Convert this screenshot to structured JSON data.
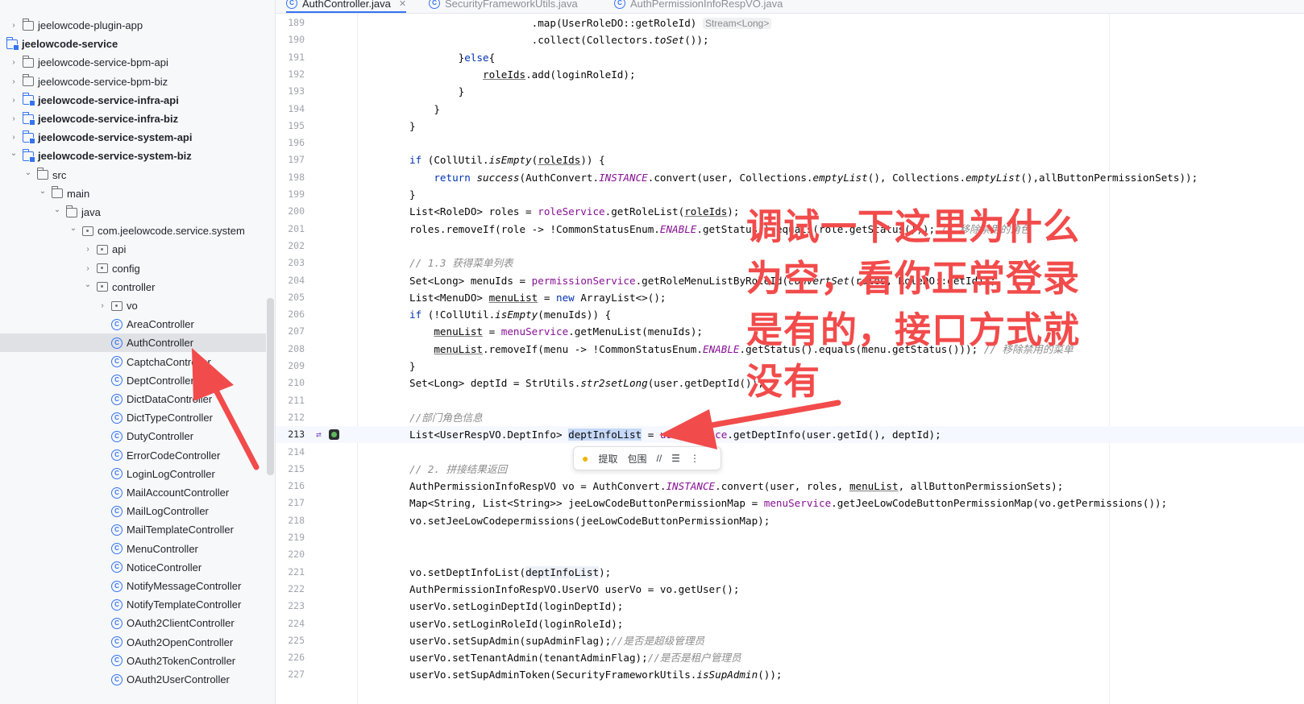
{
  "tabs": [
    {
      "label": "AuthController.java",
      "active": true
    },
    {
      "label": "SecurityFrameworkUtils.java",
      "active": false
    },
    {
      "label": "AuthPermissionInfoRespVO.java",
      "active": false
    }
  ],
  "tree": [
    {
      "label": "jeelowcode-plugin-app",
      "icon": "folder",
      "arrow": "right",
      "depth": 0,
      "bold": false
    },
    {
      "label": "jeelowcode-service",
      "icon": "module",
      "arrow": "none",
      "depth": -1,
      "bold": true
    },
    {
      "label": "jeelowcode-service-bpm-api",
      "icon": "folder",
      "arrow": "right",
      "depth": 0,
      "bold": false
    },
    {
      "label": "jeelowcode-service-bpm-biz",
      "icon": "folder",
      "arrow": "right",
      "depth": 0,
      "bold": false
    },
    {
      "label": "jeelowcode-service-infra-api",
      "icon": "module",
      "arrow": "right",
      "depth": 0,
      "bold": true
    },
    {
      "label": "jeelowcode-service-infra-biz",
      "icon": "module",
      "arrow": "right",
      "depth": 0,
      "bold": true
    },
    {
      "label": "jeelowcode-service-system-api",
      "icon": "module",
      "arrow": "right",
      "depth": 0,
      "bold": true
    },
    {
      "label": "jeelowcode-service-system-biz",
      "icon": "module",
      "arrow": "down",
      "depth": 0,
      "bold": true
    },
    {
      "label": "src",
      "icon": "folder",
      "arrow": "down",
      "depth": 1,
      "bold": false
    },
    {
      "label": "main",
      "icon": "folder",
      "arrow": "down",
      "depth": 2,
      "bold": false
    },
    {
      "label": "java",
      "icon": "folder",
      "arrow": "down",
      "depth": 3,
      "bold": false
    },
    {
      "label": "com.jeelowcode.service.system",
      "icon": "pkg",
      "arrow": "down",
      "depth": 4,
      "bold": false
    },
    {
      "label": "api",
      "icon": "pkg",
      "arrow": "right",
      "depth": 5,
      "bold": false
    },
    {
      "label": "config",
      "icon": "pkg",
      "arrow": "right",
      "depth": 5,
      "bold": false
    },
    {
      "label": "controller",
      "icon": "pkg",
      "arrow": "down",
      "depth": 5,
      "bold": false
    },
    {
      "label": "vo",
      "icon": "pkg",
      "arrow": "right",
      "depth": 6,
      "bold": false
    },
    {
      "label": "AreaController",
      "icon": "class",
      "arrow": "none",
      "depth": 6,
      "bold": false
    },
    {
      "label": "AuthController",
      "icon": "class",
      "arrow": "none",
      "depth": 6,
      "bold": false,
      "selected": true
    },
    {
      "label": "CaptchaController",
      "icon": "class",
      "arrow": "none",
      "depth": 6,
      "bold": false
    },
    {
      "label": "DeptController",
      "icon": "class",
      "arrow": "none",
      "depth": 6,
      "bold": false
    },
    {
      "label": "DictDataController",
      "icon": "class",
      "arrow": "none",
      "depth": 6,
      "bold": false
    },
    {
      "label": "DictTypeController",
      "icon": "class",
      "arrow": "none",
      "depth": 6,
      "bold": false
    },
    {
      "label": "DutyController",
      "icon": "class",
      "arrow": "none",
      "depth": 6,
      "bold": false
    },
    {
      "label": "ErrorCodeController",
      "icon": "class",
      "arrow": "none",
      "depth": 6,
      "bold": false
    },
    {
      "label": "LoginLogController",
      "icon": "class",
      "arrow": "none",
      "depth": 6,
      "bold": false
    },
    {
      "label": "MailAccountController",
      "icon": "class",
      "arrow": "none",
      "depth": 6,
      "bold": false
    },
    {
      "label": "MailLogController",
      "icon": "class",
      "arrow": "none",
      "depth": 6,
      "bold": false
    },
    {
      "label": "MailTemplateController",
      "icon": "class",
      "arrow": "none",
      "depth": 6,
      "bold": false
    },
    {
      "label": "MenuController",
      "icon": "class",
      "arrow": "none",
      "depth": 6,
      "bold": false
    },
    {
      "label": "NoticeController",
      "icon": "class",
      "arrow": "none",
      "depth": 6,
      "bold": false
    },
    {
      "label": "NotifyMessageController",
      "icon": "class",
      "arrow": "none",
      "depth": 6,
      "bold": false
    },
    {
      "label": "NotifyTemplateController",
      "icon": "class",
      "arrow": "none",
      "depth": 6,
      "bold": false
    },
    {
      "label": "OAuth2ClientController",
      "icon": "class",
      "arrow": "none",
      "depth": 6,
      "bold": false
    },
    {
      "label": "OAuth2OpenController",
      "icon": "class",
      "arrow": "none",
      "depth": 6,
      "bold": false
    },
    {
      "label": "OAuth2TokenController",
      "icon": "class",
      "arrow": "none",
      "depth": 6,
      "bold": false
    },
    {
      "label": "OAuth2UserController",
      "icon": "class",
      "arrow": "none",
      "depth": 6,
      "bold": false
    }
  ],
  "code": [
    {
      "n": "189",
      "html": "                    .map(UserRoleDO::getRoleId) <span class=\"hint\">Stream&lt;Long&gt;</span>"
    },
    {
      "n": "190",
      "html": "                    .collect(Collectors.<span class=\"it\">toSet</span>());"
    },
    {
      "n": "191",
      "html": "        }<span class=\"k\">else</span>{"
    },
    {
      "n": "192",
      "html": "            <span class=\"u\">roleIds</span>.add(loginRoleId);"
    },
    {
      "n": "193",
      "html": "        }"
    },
    {
      "n": "194",
      "html": "    }"
    },
    {
      "n": "195",
      "html": "}"
    },
    {
      "n": "196",
      "html": ""
    },
    {
      "n": "197",
      "html": "<span class=\"k\">if</span> (CollUtil.<span class=\"it\">isEmpty</span>(<span class=\"u\">roleIds</span>)) {"
    },
    {
      "n": "198",
      "html": "    <span class=\"k\">return</span> <span class=\"it\">success</span>(AuthConvert.<span class=\"st\">INSTANCE</span>.convert(user, Collections.<span class=\"it\">emptyList</span>(), Collections.<span class=\"it\">emptyList</span>(),allButtonPermissionSets));"
    },
    {
      "n": "199",
      "html": "}"
    },
    {
      "n": "200",
      "html": "List&lt;RoleDO&gt; roles = <span class=\"f\">roleService</span>.getRoleList(<span class=\"u\">roleIds</span>);"
    },
    {
      "n": "201",
      "html": "roles.removeIf(role -&gt; !CommonStatusEnum.<span class=\"st\">ENABLE</span>.getStatus().equals(role.getStatus())); <span class=\"cm\">// 移除禁用的角色</span>"
    },
    {
      "n": "202",
      "html": ""
    },
    {
      "n": "203",
      "html": "<span class=\"cm\">// 1.3 获得菜单列表</span>"
    },
    {
      "n": "204",
      "html": "Set&lt;Long&gt; menuIds = <span class=\"f\">permissionService</span>.getRoleMenuListByRoleId(<span class=\"it\">convertSet</span>(roles, RoleDO::getId));"
    },
    {
      "n": "205",
      "html": "List&lt;MenuDO&gt; <span class=\"u\">menuList</span> = <span class=\"k\">new</span> ArrayList&lt;&gt;();"
    },
    {
      "n": "206",
      "html": "<span class=\"k\">if</span> (!CollUtil.<span class=\"it\">isEmpty</span>(menuIds)) {"
    },
    {
      "n": "207",
      "html": "    <span class=\"u\">menuList</span> = <span class=\"f\">menuService</span>.getMenuList(menuIds);"
    },
    {
      "n": "208",
      "html": "    <span class=\"u\">menuList</span>.removeIf(menu -&gt; !CommonStatusEnum.<span class=\"st\">ENABLE</span>.getStatus().equals(menu.getStatus())); <span class=\"cm\">// 移除禁用的菜单</span>"
    },
    {
      "n": "209",
      "html": "}"
    },
    {
      "n": "210",
      "html": "Set&lt;Long&gt; deptId = StrUtils.<span class=\"it\">str2setLong</span>(user.getDeptId());"
    },
    {
      "n": "211",
      "html": ""
    },
    {
      "n": "212",
      "html": "<span class=\"cm\">//部门角色信息</span>"
    },
    {
      "n": "213",
      "html": "List&lt;UserRespVO.DeptInfo&gt; <span class=\"sel\">deptInfoList</span> = <span class=\"f\">userService</span>.getDeptInfo(user.getId(), deptId);",
      "current": true
    },
    {
      "n": "214",
      "html": ""
    },
    {
      "n": "215",
      "html": "<span class=\"cm\">// 2. 拼接结果返回</span>"
    },
    {
      "n": "216",
      "html": "AuthPermissionInfoRespVO vo = AuthConvert.<span class=\"st\">INSTANCE</span>.convert(user, roles, <span class=\"u\">menuList</span>, allButtonPermissionSets);"
    },
    {
      "n": "217",
      "html": "Map&lt;String, List&lt;String&gt;&gt; jeeLowCodeButtonPermissionMap = <span class=\"f\">menuService</span>.getJeeLowCodeButtonPermissionMap(vo.getPermissions());"
    },
    {
      "n": "218",
      "html": "vo.setJeeLowCodepermissions(jeeLowCodeButtonPermissionMap);"
    },
    {
      "n": "219",
      "html": ""
    },
    {
      "n": "220",
      "html": ""
    },
    {
      "n": "221",
      "html": "vo.setDeptInfoList(<span class=\"sel\" style=\"background:#edf1f7\">deptInfoList</span>);"
    },
    {
      "n": "222",
      "html": "AuthPermissionInfoRespVO.UserVO userVo = vo.getUser();"
    },
    {
      "n": "223",
      "html": "userVo.setLoginDeptId(loginDeptId);"
    },
    {
      "n": "224",
      "html": "userVo.setLoginRoleId(loginRoleId);"
    },
    {
      "n": "225",
      "html": "userVo.setSupAdmin(supAdminFlag);<span class=\"cm\">//是否是超级管理员</span>"
    },
    {
      "n": "226",
      "html": "userVo.setTenantAdmin(tenantAdminFlag);<span class=\"cm\">//是否是租户管理员</span>"
    },
    {
      "n": "227",
      "html": "userVo.setSupAdminToken(SecurityFrameworkUtils.<span class=\"it\">isSupAdmin</span>());"
    }
  ],
  "float_bar": {
    "extract": "提取",
    "surround": "包围"
  },
  "annotation": "调试一下这里为什么为空，看你正常登录是有的，接口方式就没有",
  "colors": {
    "accent": "#3574f0",
    "annotation": "#f24b4b"
  }
}
